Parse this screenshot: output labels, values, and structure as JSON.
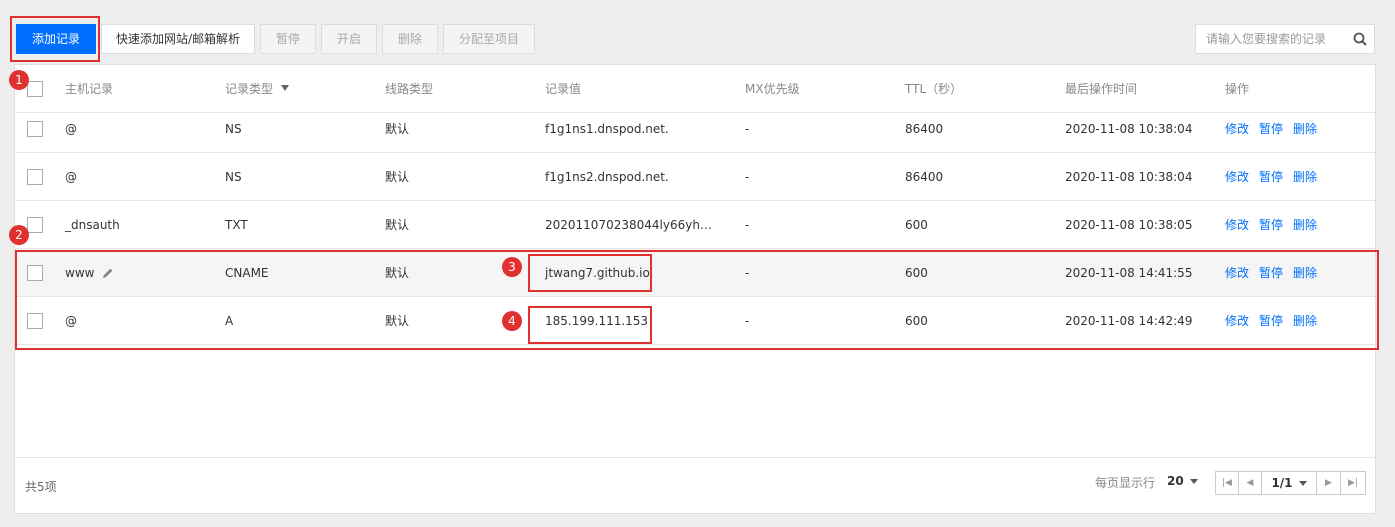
{
  "toolbar": {
    "add_record": "添加记录",
    "quick_add": "快速添加网站/邮箱解析",
    "pause": "暂停",
    "enable": "开启",
    "delete": "删除",
    "assign_project": "分配至项目"
  },
  "search": {
    "placeholder": "请输入您要搜索的记录"
  },
  "table": {
    "headers": {
      "host": "主机记录",
      "type": "记录类型",
      "line": "线路类型",
      "value": "记录值",
      "mx": "MX优先级",
      "ttl": "TTL（秒）",
      "time": "最后操作时间",
      "ops": "操作"
    },
    "rows": [
      {
        "host": "@",
        "type": "NS",
        "line": "默认",
        "value": "f1g1ns1.dnspod.net.",
        "mx": "-",
        "ttl": "86400",
        "time": "2020-11-08 10:38:04",
        "op_edit": "修改",
        "op_pause": "暂停",
        "op_delete": "删除"
      },
      {
        "host": "@",
        "type": "NS",
        "line": "默认",
        "value": "f1g1ns2.dnspod.net.",
        "mx": "-",
        "ttl": "86400",
        "time": "2020-11-08 10:38:04",
        "op_edit": "修改",
        "op_pause": "暂停",
        "op_delete": "删除"
      },
      {
        "host": "_dnsauth",
        "type": "TXT",
        "line": "默认",
        "value": "202011070238044ly66yh…",
        "mx": "-",
        "ttl": "600",
        "time": "2020-11-08 10:38:05",
        "op_edit": "修改",
        "op_pause": "暂停",
        "op_delete": "删除"
      },
      {
        "host": "www",
        "type": "CNAME",
        "line": "默认",
        "value": "jtwang7.github.io.",
        "mx": "-",
        "ttl": "600",
        "time": "2020-11-08 14:41:55",
        "op_edit": "修改",
        "op_pause": "暂停",
        "op_delete": "删除"
      },
      {
        "host": "@",
        "type": "A",
        "line": "默认",
        "value": "185.199.111.153",
        "mx": "-",
        "ttl": "600",
        "time": "2020-11-08 14:42:49",
        "op_edit": "修改",
        "op_pause": "暂停",
        "op_delete": "删除"
      }
    ]
  },
  "footer": {
    "total": "共5项",
    "per_page_label": "每页显示行",
    "per_page_value": "20",
    "page_indicator": "1/1"
  },
  "annotations": {
    "b1": "1",
    "b2": "2",
    "b3": "3",
    "b4": "4"
  },
  "colors": {
    "primary": "#006eff",
    "annotation_red": "#e03030"
  },
  "icons": [
    "filter-icon",
    "search-icon",
    "edit-pencil-icon",
    "chevron-down-icon",
    "first-page-icon",
    "prev-page-icon",
    "next-page-icon",
    "last-page-icon"
  ]
}
